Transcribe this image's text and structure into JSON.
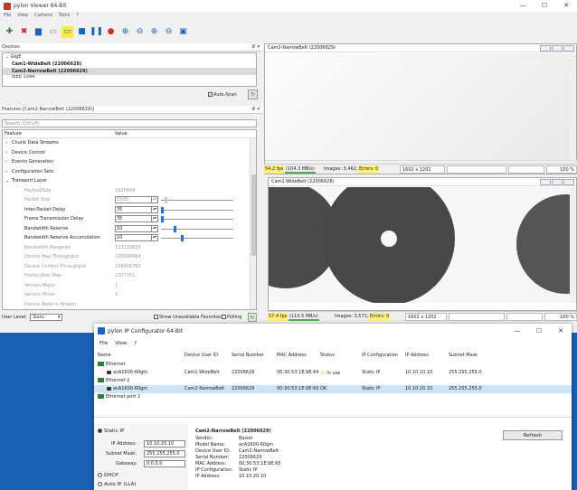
{
  "viewer": {
    "title": "pylon Viewer 64-Bit",
    "menu": [
      "File",
      "View",
      "Camera",
      "Tools",
      "?"
    ],
    "win_controls": [
      "—",
      "☐",
      "✕"
    ]
  },
  "devices": {
    "header": "Devices",
    "pin": "₽ ✕",
    "root": "GigE",
    "items": [
      "Cam1-WideBelt (22006628)",
      "Cam2-NarrowBelt (22006629)",
      "IEEE 1394"
    ],
    "auto_scan_label": "Auto-Scan"
  },
  "features": {
    "header": "Features [Cam2-NarrowBelt (22006629)]",
    "search_placeholder": "Search (Ctrl+F)",
    "col_feature": "Feature",
    "col_value": "Value",
    "rows": [
      {
        "name": "Chunk Data Streams",
        "value": "",
        "type": "group"
      },
      {
        "name": "Device Control",
        "value": "",
        "type": "group"
      },
      {
        "name": "Events Generation",
        "value": "",
        "type": "group"
      },
      {
        "name": "Configuration Sets",
        "value": "",
        "type": "group"
      },
      {
        "name": "Transport Layer",
        "value": "",
        "type": "group-open"
      },
      {
        "name": "PayloadSize",
        "value": "1925604",
        "type": "ro"
      },
      {
        "name": "Packet Size",
        "value": "1500",
        "type": "ro-spin"
      },
      {
        "name": "Inter-Packet Delay",
        "value": "35",
        "type": "spin"
      },
      {
        "name": "Frame Transmission Delay",
        "value": "35",
        "type": "spin"
      },
      {
        "name": "Bandwidth Reserve",
        "value": "10",
        "type": "spin"
      },
      {
        "name": "Bandwidth Reserve Accumulation",
        "value": "10",
        "type": "spin"
      },
      {
        "name": "Bandwidth Assigned",
        "value": "122218830",
        "type": "ro"
      },
      {
        "name": "Device Max Throughput",
        "value": "126699464",
        "type": "ro"
      },
      {
        "name": "Device Current Throughput",
        "value": "109956765",
        "type": "ro"
      },
      {
        "name": "Frame Jitter Max",
        "value": "2307151",
        "type": "ro"
      },
      {
        "name": "Version Major",
        "value": "1",
        "type": "ro"
      },
      {
        "name": "Version Minor",
        "value": "1",
        "type": "ro"
      },
      {
        "name": "Device Mode Is Broken",
        "value": "",
        "type": "ro"
      }
    ],
    "user_level_label": "User Level:",
    "user_level_value": "Guru",
    "show_unavailable_label": "Show Unavailable Favorites",
    "polling_label": "Polling"
  },
  "cam2": {
    "title": "Cam2-NarrowBelt (22006629)",
    "fps": "54.2 fps",
    "mbps": "(104.3 MB/s)",
    "images": "Images: 3,462;",
    "errors": "Errors: 0",
    "resolution": "1602 x 1202",
    "zoom": "100 %"
  },
  "cam1": {
    "title": "Cam1-WideBelt (22006628)",
    "fps": "57.4 fps",
    "mbps": "(110.5 MB/s)",
    "images": "Images: 3,571;",
    "errors": "Errors: 0",
    "resolution": "1602 x 1202",
    "zoom": "100 %"
  },
  "ipconfig": {
    "title": "pylon IP Configurator 64-Bit",
    "menu": [
      "File",
      "View",
      "?"
    ],
    "columns": [
      "Name",
      "Device User ID",
      "Serial Number",
      "MAC Address",
      "Status",
      "IP Configuration",
      "IP Address",
      "Subnet Mask"
    ],
    "rows": [
      {
        "kind": "eth",
        "name": "Ethernet"
      },
      {
        "kind": "cam",
        "name": "acA1600-60gm",
        "user_id": "Cam1-WideBelt",
        "serial": "22006628",
        "mac": "00:30:53:1E:9E:64",
        "status": "In use",
        "ipconf": "Static IP",
        "ip": "10.10.10.10",
        "mask": "255.255.255.0"
      },
      {
        "kind": "eth",
        "name": "Ethernet 2"
      },
      {
        "kind": "cam",
        "name": "acA1600-60gm",
        "user_id": "Cam2-NarrowBelt",
        "serial": "22006629",
        "mac": "00:30:53:1E:9E:65",
        "status": "OK",
        "ipconf": "Static IP",
        "ip": "10.10.20.10",
        "mask": "255.255.255.0"
      },
      {
        "kind": "eth",
        "name": "Ethernet port 2"
      }
    ],
    "static_ip_label": "Static IP",
    "ip_label": "IP Address:",
    "ip_value": "10.10.20.10",
    "mask_label": "Subnet Mask:",
    "mask_value": "255.255.255.0",
    "gateway_label": "Gateway:",
    "gateway_value": "0.0.0.0",
    "dhcp_label": "DHCP",
    "autoip_label": "Auto IP (LLA)",
    "info_title": "Cam2-NarrowBelt (22006629)",
    "info": [
      [
        "Vendor:",
        "Basler"
      ],
      [
        "Model Name:",
        "acA1600-60gm"
      ],
      [
        "Device User ID:",
        "Cam2-NarrowBelt"
      ],
      [
        "Serial Number:",
        "22006629"
      ],
      [
        "MAC Address:",
        "00:30:53:1E:9E:65"
      ],
      [
        "IP Configuration:",
        "Static IP"
      ],
      [
        "IP Address:",
        "10.10.20.10"
      ]
    ],
    "refresh_label": "Refresh"
  },
  "colors": {
    "highlight": "#fff176",
    "accent": "#1a73e8",
    "desktop": "#1a5fb4"
  }
}
